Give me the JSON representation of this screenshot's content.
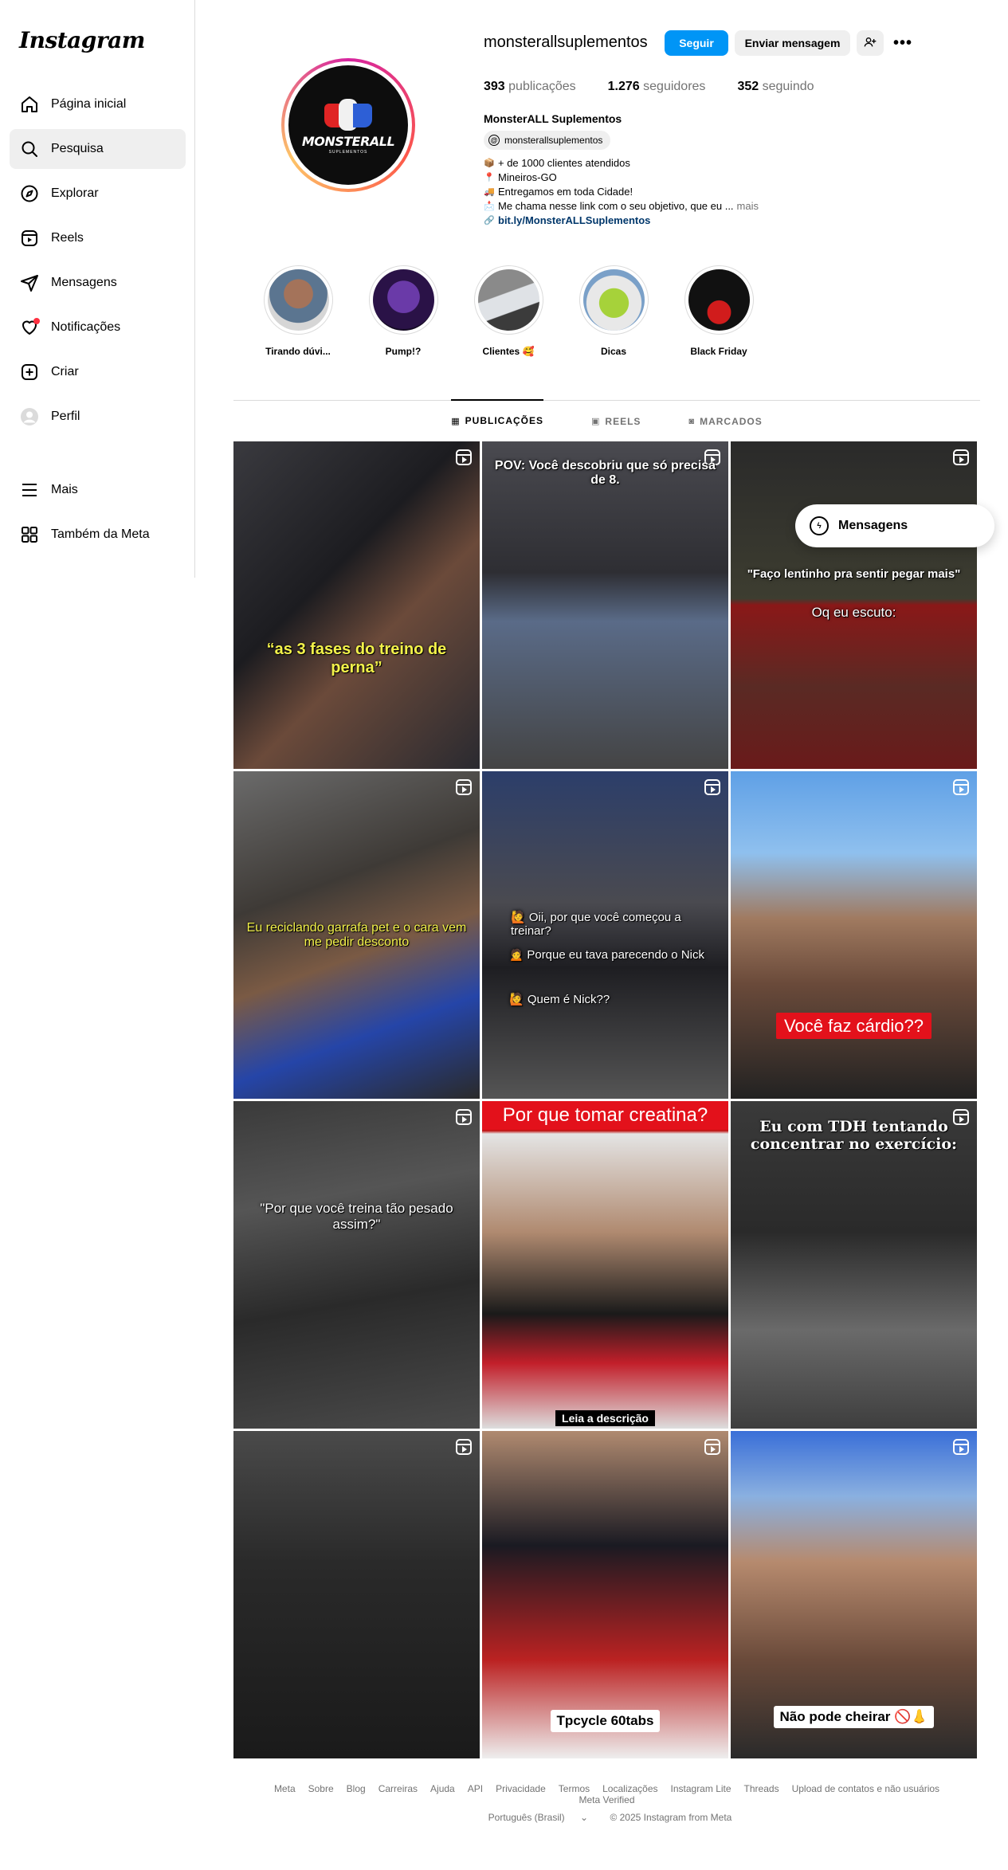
{
  "app": {
    "logo": "Instagram"
  },
  "sidebar": {
    "items": [
      {
        "label": "Página inicial",
        "icon": "home-icon"
      },
      {
        "label": "Pesquisa",
        "icon": "search-icon",
        "active": true
      },
      {
        "label": "Explorar",
        "icon": "compass-icon"
      },
      {
        "label": "Reels",
        "icon": "reels-icon"
      },
      {
        "label": "Mensagens",
        "icon": "send-icon"
      },
      {
        "label": "Notificações",
        "icon": "heart-icon",
        "badge_dot": true
      },
      {
        "label": "Criar",
        "icon": "plus-square-icon"
      },
      {
        "label": "Perfil",
        "icon": "avatar-icon"
      }
    ],
    "bottom_items": [
      {
        "label": "Mais",
        "icon": "menu-icon"
      },
      {
        "label": "Também da Meta",
        "icon": "grid-icon"
      }
    ]
  },
  "profile": {
    "username": "monsterallsuplementos",
    "follow_label": "Seguir",
    "message_label": "Enviar mensagem",
    "avatar_text": "MONSTERALL",
    "avatar_subtext": "SUPLEMENTOS",
    "stats": [
      {
        "value": "393",
        "label": "publicações"
      },
      {
        "value": "1.276",
        "label": "seguidores"
      },
      {
        "value": "352",
        "label": "seguindo"
      }
    ],
    "full_name": "MonsterALL Suplementos",
    "threads_handle": "monsterallsuplementos",
    "bio_lines": [
      {
        "emoji": "📦",
        "text": "+ de 1000 clientes atendidos"
      },
      {
        "emoji": "📍",
        "text": "Mineiros-GO"
      },
      {
        "emoji": "🚚",
        "text": "Entregamos em toda Cidade!"
      },
      {
        "emoji": "📩",
        "text": "Me chama nesse link com o seu objetivo, que eu ..."
      }
    ],
    "more_label": "mais",
    "link": "bit.ly/MonsterALLSuplementos"
  },
  "highlights": [
    {
      "label": "Tirando dúvi..."
    },
    {
      "label": "Pump!?"
    },
    {
      "label": "Clientes 🥰"
    },
    {
      "label": "Dicas"
    },
    {
      "label": "Black Friday"
    }
  ],
  "tabs": [
    {
      "label": "PUBLICAÇÕES",
      "active": true
    },
    {
      "label": "REELS"
    },
    {
      "label": "MARCADOS"
    }
  ],
  "posts": [
    {
      "caption": "“as 3 fases do treino de perna”"
    },
    {
      "caption": "POV: Você descobriu que só precisa de 8."
    },
    {
      "caption_top": "\"Faço lentinho pra sentir pegar mais\"",
      "caption_bottom": "Oq eu escuto:"
    },
    {
      "caption": "Eu reciclando garrafa pet e o cara vem me pedir desconto"
    },
    {
      "caption_1": "🙋 Oii, por que você começou a treinar?",
      "caption_2": "🙍 Porque eu tava parecendo o Nick",
      "caption_3": "🙋 Quem é Nick??"
    },
    {
      "caption": "Você faz cárdio??"
    },
    {
      "caption": "\"Por que você treina tão pesado assim?\""
    },
    {
      "caption_top": "Por que tomar creatina?",
      "caption_bottom": "Leia a descrição"
    },
    {
      "caption": "Eu com TDH tentando concentrar no exercício:"
    },
    {
      "caption": ""
    },
    {
      "caption": "Tpcycle 60tabs"
    },
    {
      "caption": "Não pode cheirar 🚫👃"
    }
  ],
  "floating_messages": {
    "label": "Mensagens"
  },
  "footer": {
    "links": [
      "Meta",
      "Sobre",
      "Blog",
      "Carreiras",
      "Ajuda",
      "API",
      "Privacidade",
      "Termos",
      "Localizações",
      "Instagram Lite",
      "Threads",
      "Upload de contatos e não usuários",
      "Meta Verified"
    ],
    "language": "Português (Brasil)",
    "copyright": "© 2025 Instagram from Meta"
  },
  "colors": {
    "primary_button": "#0095f6",
    "notification_dot": "#ff3040",
    "link": "#00376b"
  }
}
